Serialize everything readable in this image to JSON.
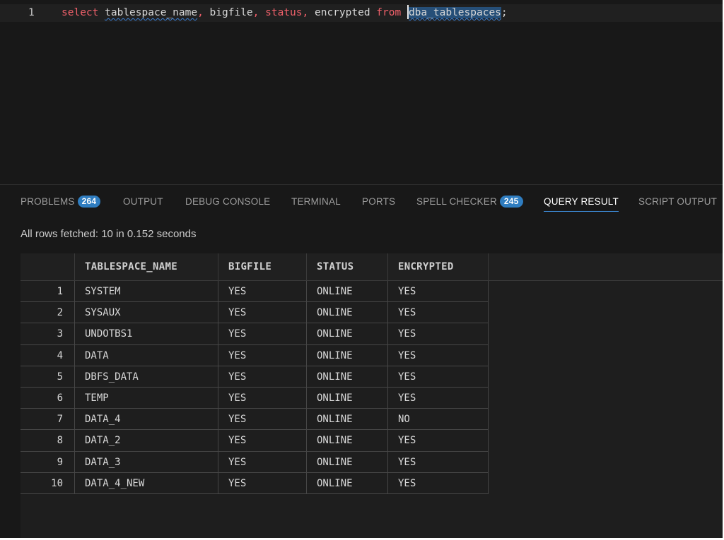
{
  "editor": {
    "line_number": "1",
    "query": {
      "kw_select": "select",
      "col1": "tablespace_name",
      "comma1": ",",
      "col2": "bigfile",
      "comma2": ",",
      "col3": "status",
      "comma3": ",",
      "col4": "encrypted",
      "kw_from": "from",
      "table": "dba_tablespaces",
      "semicolon": ";"
    }
  },
  "panel": {
    "tabs": [
      {
        "label": "PROBLEMS",
        "badge": "264"
      },
      {
        "label": "OUTPUT"
      },
      {
        "label": "DEBUG CONSOLE"
      },
      {
        "label": "TERMINAL"
      },
      {
        "label": "PORTS"
      },
      {
        "label": "SPELL CHECKER",
        "badge": "245"
      },
      {
        "label": "QUERY RESULT"
      },
      {
        "label": "SCRIPT OUTPUT"
      }
    ],
    "active_tab": "QUERY RESULT",
    "status": "All rows fetched: 10 in 0.152 seconds"
  },
  "results": {
    "columns": [
      "TABLESPACE_NAME",
      "BIGFILE",
      "STATUS",
      "ENCRYPTED"
    ],
    "rows": [
      [
        "1",
        "SYSTEM",
        "YES",
        "ONLINE",
        "YES"
      ],
      [
        "2",
        "SYSAUX",
        "YES",
        "ONLINE",
        "YES"
      ],
      [
        "3",
        "UNDOTBS1",
        "YES",
        "ONLINE",
        "YES"
      ],
      [
        "4",
        "DATA",
        "YES",
        "ONLINE",
        "YES"
      ],
      [
        "5",
        "DBFS_DATA",
        "YES",
        "ONLINE",
        "YES"
      ],
      [
        "6",
        "TEMP",
        "YES",
        "ONLINE",
        "YES"
      ],
      [
        "7",
        "DATA_4",
        "YES",
        "ONLINE",
        "NO"
      ],
      [
        "8",
        "DATA_2",
        "YES",
        "ONLINE",
        "YES"
      ],
      [
        "9",
        "DATA_3",
        "YES",
        "ONLINE",
        "YES"
      ],
      [
        "10",
        "DATA_4_NEW",
        "YES",
        "ONLINE",
        "YES"
      ]
    ]
  },
  "colors": {
    "background": "#181818",
    "keyword": "#f0606a",
    "accent": "#3c8bd9",
    "badge": "#2f7dc0"
  }
}
